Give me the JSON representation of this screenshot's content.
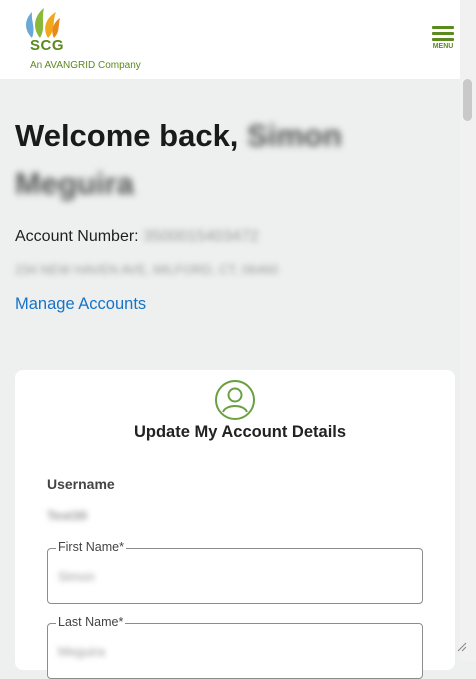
{
  "header": {
    "logo_text": "SCG",
    "logo_subtitle": "An AVANGRID Company",
    "menu_label": "MENU"
  },
  "welcome": {
    "prefix": "Welcome back,",
    "name_first": "Simon",
    "name_last": "Meguira"
  },
  "account": {
    "label": "Account Number:",
    "number": "3500015403472",
    "address": "234 NEW HAVEN AVE, MILFORD, CT, 06460",
    "manage_link": "Manage Accounts"
  },
  "card": {
    "title": "Update My Account Details",
    "username_label": "Username",
    "username_value": "Test30",
    "first_name_label": "First Name*",
    "first_name_value": "Simon",
    "last_name_label": "Last Name*",
    "last_name_value": "Meguira"
  },
  "colors": {
    "brand_green": "#5b8a1e",
    "link_blue": "#1673c8",
    "page_bg": "#eeefef"
  }
}
